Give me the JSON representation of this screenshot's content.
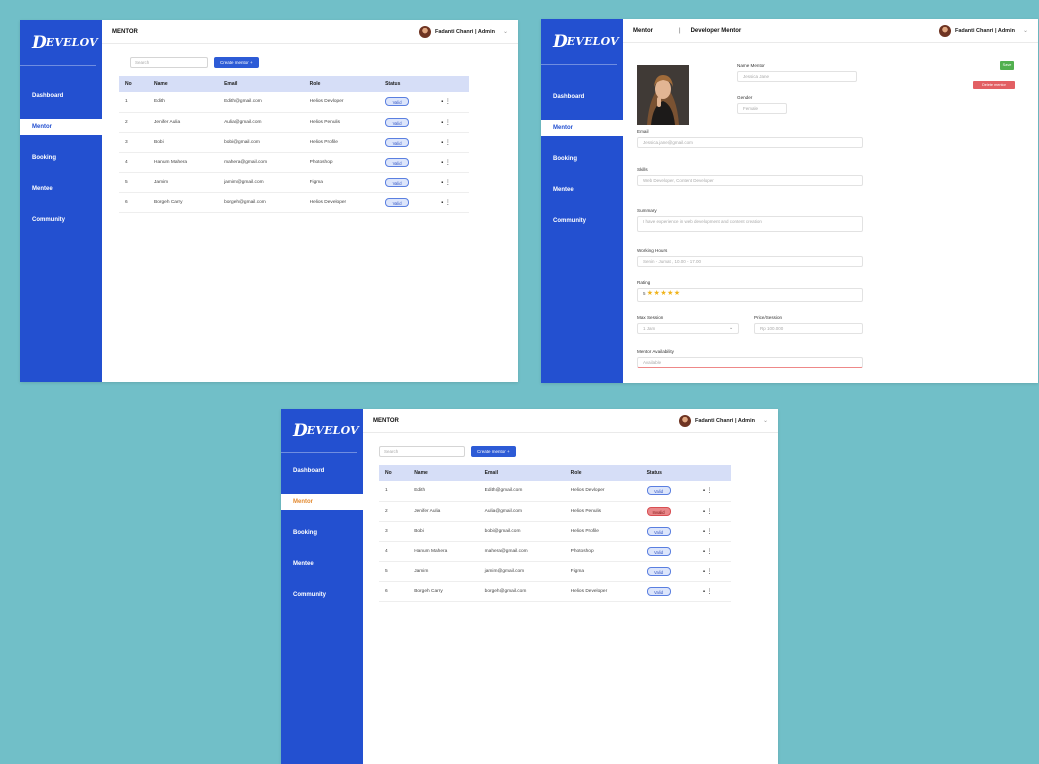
{
  "brand": {
    "logo_initial": "D",
    "logo_rest": "EVELOV"
  },
  "nav": [
    "Dashboard",
    "Mentor",
    "Booking",
    "Mentee",
    "Community"
  ],
  "user": {
    "name": "Fadanti Chanri | Admin"
  },
  "mentor_list": {
    "title": "MENTOR",
    "search_placeholder": "Search",
    "create_label": "Create mentor",
    "columns": [
      "No",
      "Name",
      "Email",
      "Role",
      "Status"
    ],
    "rows": [
      {
        "no": "1",
        "name": "Edith",
        "email": "Edith@gmail.com",
        "role": "Helios Devloper",
        "status": "Valid"
      },
      {
        "no": "2",
        "name": "Jenifer Aulia",
        "email": "Aulia@gmail.com",
        "role": "Helios Penulis",
        "status": "Valid"
      },
      {
        "no": "3",
        "name": "Bobi",
        "email": "bobi@gmail.com",
        "role": "Helios Profile",
        "status": "Valid"
      },
      {
        "no": "4",
        "name": "Hanum Mahera",
        "email": "mahera@gmail.com",
        "role": "Photoshop",
        "status": "Valid"
      },
      {
        "no": "5",
        "name": "Jamim",
        "email": "jamim@gmail.com",
        "role": "Figma",
        "status": "Valid"
      },
      {
        "no": "6",
        "name": "Borgeh Carry",
        "email": "borgeh@gmail.com",
        "role": "Helios Developer",
        "status": "Valid"
      }
    ],
    "rows_variant": [
      {
        "no": "1",
        "name": "Edith",
        "email": "Edith@gmail.com",
        "role": "Helios Devloper",
        "status": "Valid"
      },
      {
        "no": "2",
        "name": "Jenifer Aulia",
        "email": "Aulia@gmail.com",
        "role": "Helios Penulis",
        "status": "Invalid"
      },
      {
        "no": "3",
        "name": "Bobi",
        "email": "bobi@gmail.com",
        "role": "Helios Profile",
        "status": "Valid"
      },
      {
        "no": "4",
        "name": "Hanum Mahera",
        "email": "mahera@gmail.com",
        "role": "Photoshop",
        "status": "Valid"
      },
      {
        "no": "5",
        "name": "Jamim",
        "email": "jamim@gmail.com",
        "role": "Figma",
        "status": "Valid"
      },
      {
        "no": "6",
        "name": "Borgeh Carry",
        "email": "borgeh@gmail.com",
        "role": "Helios Developer",
        "status": "Valid"
      }
    ]
  },
  "edit_mentor": {
    "breadcrumb_root": "Mentor",
    "breadcrumb_sep": "|",
    "breadcrumb_current": "Developer Mentor",
    "save_label": "Save",
    "delete_label": "Delete mentor",
    "fields": {
      "name_label": "Name Mentor",
      "name_value": "Jessica Jane",
      "gender_label": "Gender",
      "gender_value": "Female",
      "email_label": "Email",
      "email_value": "Jessica.jane@gmail.com",
      "skills_label": "Skills",
      "skills_value": "Web Developer, Content Developer",
      "summary_label": "Summary",
      "summary_value": "I have experience in web development and content creation",
      "schedule_label": "Working Hours",
      "schedule_value": "Senin - Jumat , 10.00 - 17.00",
      "rating_label": "Rating",
      "rating_value": "5",
      "rating_stars": "★★★★★",
      "session_label": "Max Session",
      "session_value": "1 Jam",
      "price_label": "Price/Session",
      "price_value": "Rp 100.000",
      "status_label": "Mentor Availability",
      "status_value": "Available"
    }
  },
  "colors": {
    "background": "#71bfc8",
    "sidebar": "#2350d0",
    "header_row": "#d6def7",
    "save": "#52b04f",
    "delete": "#e25f63",
    "stars": "#f0b41c"
  }
}
